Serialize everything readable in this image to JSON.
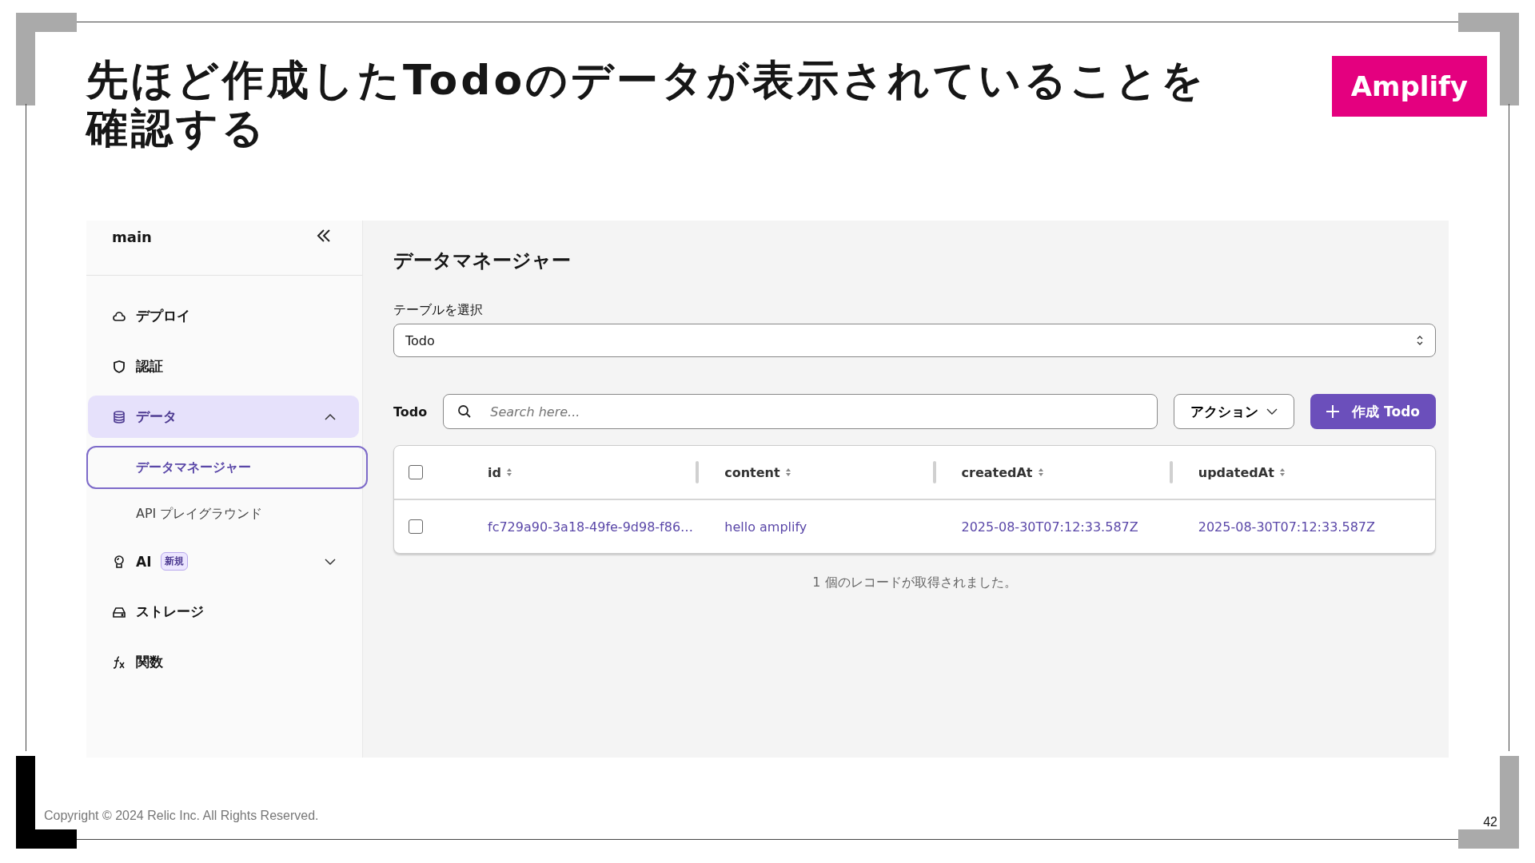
{
  "slide": {
    "title": "先ほど作成したTodoのデータが表示されていることを確認する",
    "badge": "Amplify",
    "copyright": "Copyright © 2024 Relic Inc. All Rights Reserved.",
    "page_number": "42"
  },
  "sidebar": {
    "branch": "main",
    "items": [
      {
        "label": "デプロイ",
        "selected": false
      },
      {
        "label": "認証",
        "selected": false
      },
      {
        "label": "データ",
        "selected": true,
        "expanded": true,
        "children": [
          {
            "label": "データマネージャー",
            "selected": true
          },
          {
            "label": "API プレイグラウンド",
            "selected": false
          }
        ]
      },
      {
        "label": "AI",
        "selected": false,
        "expanded": false,
        "badge": "新規"
      },
      {
        "label": "ストレージ",
        "selected": false
      },
      {
        "label": "関数",
        "selected": false
      }
    ]
  },
  "main": {
    "title": "データマネージャー",
    "table_select": {
      "label": "テーブルを選択",
      "value": "Todo"
    },
    "toolbar": {
      "label": "Todo",
      "search": {
        "placeholder": "Search here..."
      },
      "actions_button": "アクション",
      "create_button": "作成 Todo"
    },
    "table": {
      "header_checked": false,
      "columns": [
        "id",
        "content",
        "createdAt",
        "updatedAt"
      ],
      "rows": [
        {
          "checked": false,
          "cells": [
            "fc729a90-3a18-49fe-9d98-f86…",
            "hello amplify",
            "2025-08-30T07:12:33.587Z",
            "2025-08-30T07:12:33.587Z"
          ]
        }
      ]
    },
    "record_count": "1 個のレコードが取得されました。"
  }
}
